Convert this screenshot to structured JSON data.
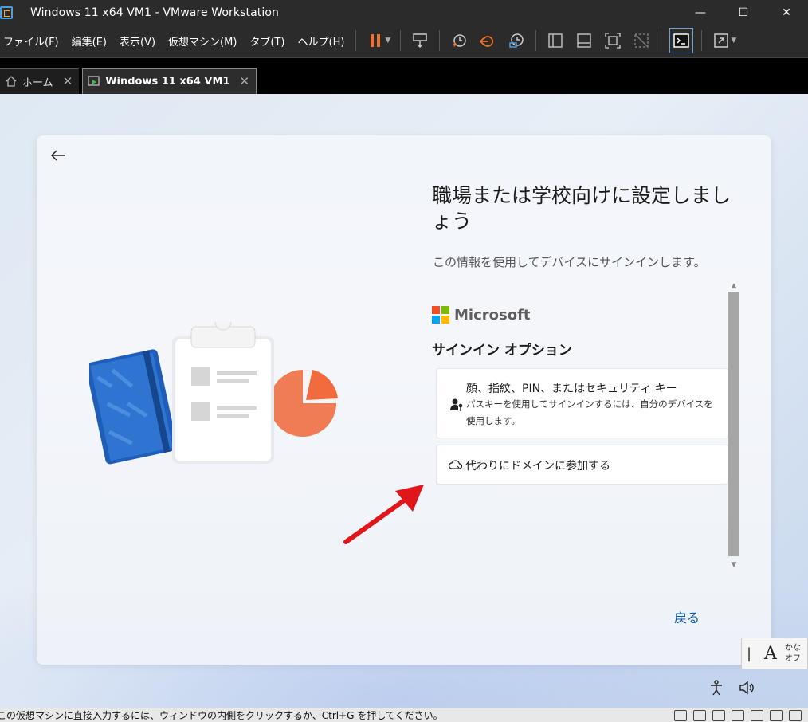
{
  "window": {
    "title": "Windows 11 x64 VM1 - VMware Workstation",
    "minimize": "—",
    "maximize": "☐",
    "close": "✕"
  },
  "menu": {
    "items": [
      "ファイル(F)",
      "編集(E)",
      "表示(V)",
      "仮想マシン(M)",
      "タブ(T)",
      "ヘルプ(H)"
    ]
  },
  "tabs": [
    {
      "label": "ホーム",
      "close": "✕"
    },
    {
      "label": "Windows 11 x64 VM1",
      "close": "✕"
    }
  ],
  "oobe": {
    "heading": "職場または学校向けに設定しましょう",
    "subtext": "この情報を使用してデバイスにサインインします。",
    "brand": "Microsoft",
    "brand_colors": [
      "#f25022",
      "#7fba00",
      "#00a4ef",
      "#ffb900"
    ],
    "signin_title": "サインイン オプション",
    "options": [
      {
        "title": "顔、指紋、PIN、またはセキュリティ キー",
        "description": "パスキーを使用してサインインするには、自分のデバイスを使用します。",
        "icon": "person-key-icon"
      },
      {
        "title": "代わりにドメインに参加する",
        "icon": "cloud-icon"
      }
    ],
    "back_link": "戻る"
  },
  "ime": {
    "mode": "A",
    "line1": "かな",
    "line2": "オフ"
  },
  "statusbar": {
    "text": "この仮想マシンに直接入力するには、ウィンドウの内側をクリックするか、Ctrl+G を押してください。"
  },
  "colors": {
    "accent_link": "#0b5cad",
    "pause_orange": "#f0712c",
    "annotation_red": "#e0161b"
  }
}
